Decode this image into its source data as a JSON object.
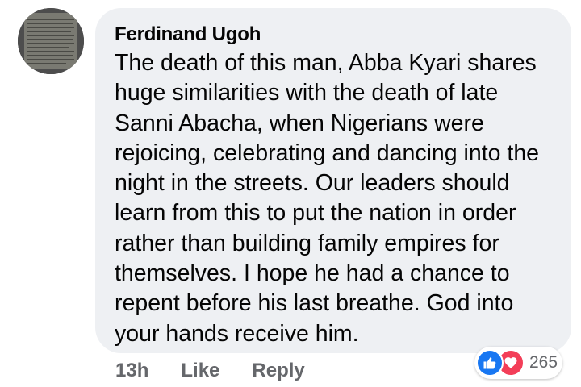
{
  "comment": {
    "author": "Ferdinand Ugoh",
    "text_lines": [
      "The death of this man, Abba Kyari shares",
      "huge similarities with the death of late",
      "Sanni Abacha, when Nigerians were",
      "rejoicing, celebrating and dancing into the",
      "night in the streets. Our leaders should",
      "learn from this to put the nation in order",
      "rather than building family empires for",
      "themselves. I hope he had a chance to",
      "repent before his last breathe. God into",
      "your hands receive him."
    ]
  },
  "meta": {
    "time": "13h",
    "like_label": "Like",
    "reply_label": "Reply"
  },
  "reactions": {
    "icons": [
      "thumbs-up-icon",
      "heart-icon"
    ],
    "count": "265",
    "colors": {
      "like": "#1877f2",
      "love": "#f33e58"
    }
  },
  "colors": {
    "bubble_bg": "#eef0f3",
    "text": "#050505",
    "meta_text": "#65676b"
  }
}
